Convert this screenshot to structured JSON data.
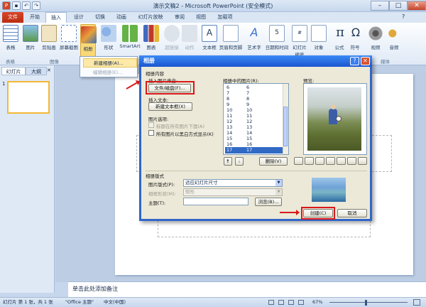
{
  "app": {
    "title": "演示文稿2 - Microsoft PowerPoint (安全模式)"
  },
  "tabs": [
    "文件",
    "开始",
    "插入",
    "设计",
    "切换",
    "动画",
    "幻灯片放映",
    "审阅",
    "视图",
    "加载项"
  ],
  "ribbon": {
    "buttons": [
      "表格",
      "图片",
      "剪贴画",
      "屏幕截图",
      "相册",
      "形状",
      "SmartArt",
      "图表",
      "超链接",
      "动作",
      "文本框",
      "页眉和页脚",
      "艺术字",
      "日期和时间",
      "幻灯片编号",
      "对象",
      "公式",
      "符号",
      "视频",
      "音频"
    ],
    "groups": [
      "表格",
      "图像",
      "媒体"
    ]
  },
  "album_menu": {
    "new": "新建相册(A)...",
    "edit": "编辑相册(E)..."
  },
  "left_pane": {
    "tab_slides": "幻灯片",
    "tab_outline": "大纲",
    "slide_num": "1"
  },
  "dialog": {
    "title": "相册",
    "section_content": "相册内容",
    "insert_from": "插入图片来自:",
    "file_disk_btn": "文件/磁盘(F)...",
    "insert_text": "插入文本:",
    "new_textbox_btn": "新建文本框(X)",
    "picture_options": "图片选项:",
    "captions_below": "标题在所有图片下面(A)",
    "all_bw": "所有图片以黑白方式显示(K)",
    "pictures_in_album": "相册中的图片(R):",
    "list": [
      [
        "6",
        "6"
      ],
      [
        "7",
        "7"
      ],
      [
        "8",
        "8"
      ],
      [
        "9",
        "9"
      ],
      [
        "10",
        "10"
      ],
      [
        "11",
        "11"
      ],
      [
        "12",
        "12"
      ],
      [
        "13",
        "13"
      ],
      [
        "14",
        "14"
      ],
      [
        "15",
        "15"
      ],
      [
        "16",
        "16"
      ],
      [
        "17",
        "17"
      ]
    ],
    "selected_row": "17",
    "up_arrow": "↑",
    "down_arrow": "↓",
    "remove_btn": "删除(V)",
    "preview_label": "预览:",
    "section_layout": "相册版式",
    "picture_layout_label": "图片版式(P):",
    "picture_layout_value": "适应幻灯片尺寸",
    "frame_shape_label": "相框形状(M):",
    "frame_shape_value": "矩形",
    "theme_label": "主题(T):",
    "theme_value": "",
    "browse_btn": "浏览(B)...",
    "create_btn": "创建(C)",
    "cancel_btn": "取消"
  },
  "notes": {
    "placeholder": "单击此处添加备注"
  },
  "status": {
    "slide": "幻灯片 第 1 张，共 1 张",
    "theme": "\"Office 主题\"",
    "lang": "中文(中国)",
    "zoom": "67%"
  },
  "colors": {
    "accent": "#d9191b",
    "file_tab": "#c43c1c",
    "dialog_title": "#1b55d0"
  }
}
